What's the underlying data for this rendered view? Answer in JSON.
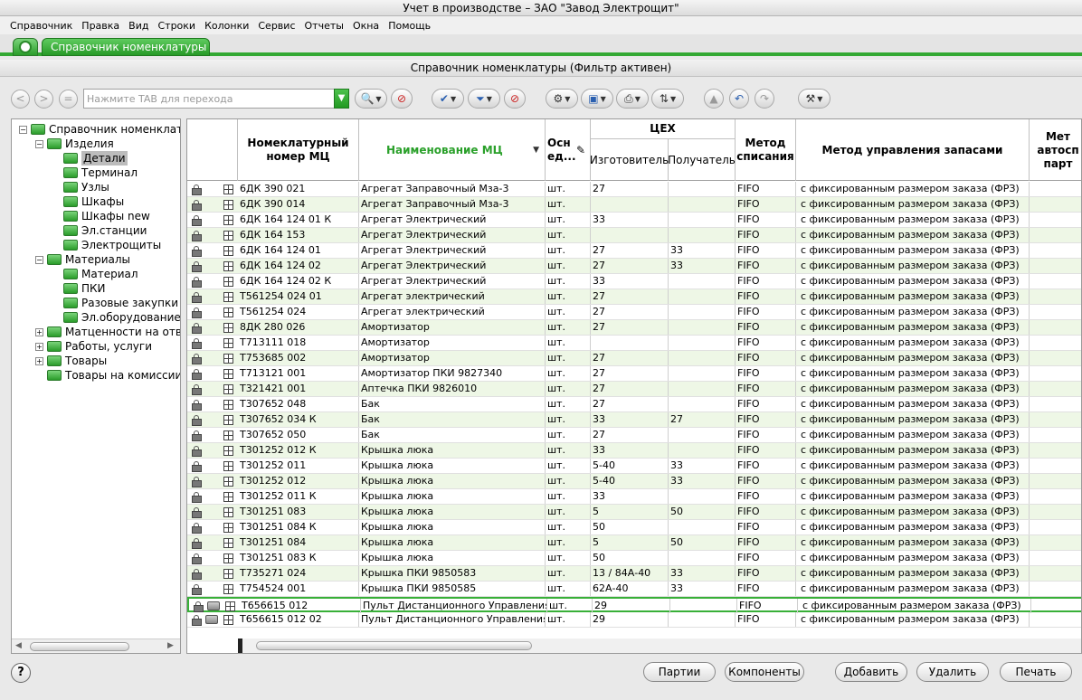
{
  "window": {
    "title": "Учет в производстве – ЗАО \"Завод  Электрощит\""
  },
  "menu": [
    "Справочник",
    "Правка",
    "Вид",
    "Строки",
    "Колонки",
    "Сервис",
    "Отчеты",
    "Окна",
    "Помощь"
  ],
  "tabs": {
    "active": "Справочник номенклатуры"
  },
  "panel": {
    "title": "Справочник номенклатуры (Фильтр активен)"
  },
  "toolbar": {
    "search_placeholder": "Нажмите TAB для перехода"
  },
  "tree": [
    {
      "label": "Справочник номенклатуры",
      "level": 0,
      "expander": "−"
    },
    {
      "label": "Изделия",
      "level": 1,
      "expander": "−"
    },
    {
      "label": "Детали",
      "level": 2,
      "expander": "",
      "selected": true
    },
    {
      "label": "Терминал",
      "level": 2,
      "expander": ""
    },
    {
      "label": "Узлы",
      "level": 2,
      "expander": ""
    },
    {
      "label": "Шкафы",
      "level": 2,
      "expander": ""
    },
    {
      "label": "Шкафы new",
      "level": 2,
      "expander": ""
    },
    {
      "label": "Эл.станции",
      "level": 2,
      "expander": ""
    },
    {
      "label": "Электрощиты",
      "level": 2,
      "expander": ""
    },
    {
      "label": "Материалы",
      "level": 1,
      "expander": "−"
    },
    {
      "label": "Материал",
      "level": 2,
      "expander": ""
    },
    {
      "label": "ПКИ",
      "level": 2,
      "expander": ""
    },
    {
      "label": "Разовые закупки",
      "level": 2,
      "expander": ""
    },
    {
      "label": "Эл.оборудование",
      "level": 2,
      "expander": ""
    },
    {
      "label": "Матценности на ответ",
      "level": 1,
      "expander": "+"
    },
    {
      "label": "Работы, услуги",
      "level": 1,
      "expander": "+"
    },
    {
      "label": "Товары",
      "level": 1,
      "expander": "+"
    },
    {
      "label": "Товары на комиссии",
      "level": 1,
      "expander": ""
    }
  ],
  "grid": {
    "headers": {
      "number": "Номеклатурный номер МЦ",
      "name": "Наименование  МЦ",
      "unit": "Осн ед...",
      "shop": "ЦЕХ",
      "maker": "Изготовитель",
      "receiver": "Получатель",
      "write_off": "Метод списания",
      "stock": "Метод управления запасами",
      "auto": "Мет автосп парт"
    },
    "rows": [
      {
        "num": "6ДК 390 021",
        "name": "Агрегат Заправочный Мза-3",
        "unit": "шт.",
        "maker": "27",
        "recv": "",
        "wo": "FIFO",
        "stock": "с фиксированным размером заказа (ФРЗ)"
      },
      {
        "num": "6ДК 390 014",
        "name": "Агрегат Заправочный Мза-3",
        "unit": "шт.",
        "maker": "",
        "recv": "",
        "wo": "FIFO",
        "stock": "с фиксированным размером заказа (ФРЗ)"
      },
      {
        "num": "6ДК 164 124 01 К",
        "name": "Агрегат Электрический",
        "unit": "шт.",
        "maker": "33",
        "recv": "",
        "wo": "FIFO",
        "stock": "с фиксированным размером заказа (ФРЗ)"
      },
      {
        "num": "6ДК 164 153",
        "name": "Агрегат Электрический",
        "unit": "шт.",
        "maker": "",
        "recv": "",
        "wo": "FIFO",
        "stock": "с фиксированным размером заказа (ФРЗ)"
      },
      {
        "num": "6ДК 164 124 01",
        "name": "Агрегат Электрический",
        "unit": "шт.",
        "maker": "27",
        "recv": "33",
        "wo": "FIFO",
        "stock": "с фиксированным размером заказа (ФРЗ)"
      },
      {
        "num": "6ДК 164 124 02",
        "name": "Агрегат Электрический",
        "unit": "шт.",
        "maker": "27",
        "recv": "33",
        "wo": "FIFO",
        "stock": "с фиксированным размером заказа (ФРЗ)"
      },
      {
        "num": "6ДК 164 124 02 К",
        "name": "Агрегат Электрический",
        "unit": "шт.",
        "maker": "33",
        "recv": "",
        "wo": "FIFO",
        "stock": "с фиксированным размером заказа (ФРЗ)"
      },
      {
        "num": "Т561254 024 01",
        "name": "Агрегат электрический",
        "unit": "шт.",
        "maker": "27",
        "recv": "",
        "wo": "FIFO",
        "stock": "с фиксированным размером заказа (ФРЗ)"
      },
      {
        "num": "Т561254 024",
        "name": "Агрегат электрический",
        "unit": "шт.",
        "maker": "27",
        "recv": "",
        "wo": "FIFO",
        "stock": "с фиксированным размером заказа (ФРЗ)"
      },
      {
        "num": "8ДК 280 026",
        "name": "Амортизатор",
        "unit": "шт.",
        "maker": "27",
        "recv": "",
        "wo": "FIFO",
        "stock": "с фиксированным размером заказа (ФРЗ)"
      },
      {
        "num": "Т713111 018",
        "name": "Амортизатор",
        "unit": "шт.",
        "maker": "",
        "recv": "",
        "wo": "FIFO",
        "stock": "с фиксированным размером заказа (ФРЗ)"
      },
      {
        "num": "Т753685 002",
        "name": "Амортизатор",
        "unit": "шт.",
        "maker": "27",
        "recv": "",
        "wo": "FIFO",
        "stock": "с фиксированным размером заказа (ФРЗ)"
      },
      {
        "num": "Т713121 001",
        "name": "Амортизатор ПКИ 9827340",
        "unit": "шт.",
        "maker": "27",
        "recv": "",
        "wo": "FIFO",
        "stock": "с фиксированным размером заказа (ФРЗ)"
      },
      {
        "num": "Т321421 001",
        "name": "Аптечка ПКИ 9826010",
        "unit": "шт.",
        "maker": "27",
        "recv": "",
        "wo": "FIFO",
        "stock": "с фиксированным размером заказа (ФРЗ)"
      },
      {
        "num": "Т307652 048",
        "name": "Бак",
        "unit": "шт.",
        "maker": "27",
        "recv": "",
        "wo": "FIFO",
        "stock": "с фиксированным размером заказа (ФРЗ)"
      },
      {
        "num": "Т307652 034 К",
        "name": "Бак",
        "unit": "шт.",
        "maker": "33",
        "recv": "27",
        "wo": "FIFO",
        "stock": "с фиксированным размером заказа (ФРЗ)"
      },
      {
        "num": "Т307652 050",
        "name": "Бак",
        "unit": "шт.",
        "maker": "27",
        "recv": "",
        "wo": "FIFO",
        "stock": "с фиксированным размером заказа (ФРЗ)"
      },
      {
        "num": "Т301252 012 К",
        "name": "Крышка люка",
        "unit": "шт.",
        "maker": "33",
        "recv": "",
        "wo": "FIFO",
        "stock": "с фиксированным размером заказа (ФРЗ)"
      },
      {
        "num": "Т301252 011",
        "name": "Крышка люка",
        "unit": "шт.",
        "maker": "5-40",
        "recv": "33",
        "wo": "FIFO",
        "stock": "с фиксированным размером заказа (ФРЗ)"
      },
      {
        "num": "Т301252 012",
        "name": "Крышка люка",
        "unit": "шт.",
        "maker": "5-40",
        "recv": "33",
        "wo": "FIFO",
        "stock": "с фиксированным размером заказа (ФРЗ)"
      },
      {
        "num": "Т301252 011 К",
        "name": "Крышка люка",
        "unit": "шт.",
        "maker": "33",
        "recv": "",
        "wo": "FIFO",
        "stock": "с фиксированным размером заказа (ФРЗ)"
      },
      {
        "num": "Т301251 083",
        "name": "Крышка люка",
        "unit": "шт.",
        "maker": "5",
        "recv": "50",
        "wo": "FIFO",
        "stock": "с фиксированным размером заказа (ФРЗ)"
      },
      {
        "num": "Т301251 084 К",
        "name": "Крышка люка",
        "unit": "шт.",
        "maker": "50",
        "recv": "",
        "wo": "FIFO",
        "stock": "с фиксированным размером заказа (ФРЗ)"
      },
      {
        "num": "Т301251 084",
        "name": "Крышка люка",
        "unit": "шт.",
        "maker": "5",
        "recv": "50",
        "wo": "FIFO",
        "stock": "с фиксированным размером заказа (ФРЗ)"
      },
      {
        "num": "Т301251 083 К",
        "name": "Крышка люка",
        "unit": "шт.",
        "maker": "50",
        "recv": "",
        "wo": "FIFO",
        "stock": "с фиксированным размером заказа (ФРЗ)"
      },
      {
        "num": "Т735271 024",
        "name": "Крышка ПКИ 9850583",
        "unit": "шт.",
        "maker": "13 / 84А-40",
        "recv": "33",
        "wo": "FIFO",
        "stock": "с фиксированным размером заказа (ФРЗ)"
      },
      {
        "num": "Т754524 001",
        "name": "Крышка ПКИ 9850585",
        "unit": "шт.",
        "maker": "62А-40",
        "recv": "33",
        "wo": "FIFO",
        "stock": "с фиксированным размером заказа (ФРЗ)"
      },
      {
        "num": "Т656615 012",
        "name": "Пульт Дистанционного Управления",
        "unit": "шт.",
        "maker": "29",
        "recv": "",
        "wo": "FIFO",
        "stock": "с фиксированным размером заказа (ФРЗ)",
        "selected": true,
        "box": true
      },
      {
        "num": "Т656615 012 02",
        "name": "Пульт Дистанционного Управления",
        "unit": "шт.",
        "maker": "29",
        "recv": "",
        "wo": "FIFO",
        "stock": "с фиксированным размером заказа (ФРЗ)",
        "box": true
      }
    ]
  },
  "footer": {
    "help": "?",
    "parties": "Партии",
    "components": "Компоненты",
    "add": "Добавить",
    "delete": "Удалить",
    "print": "Печать"
  }
}
